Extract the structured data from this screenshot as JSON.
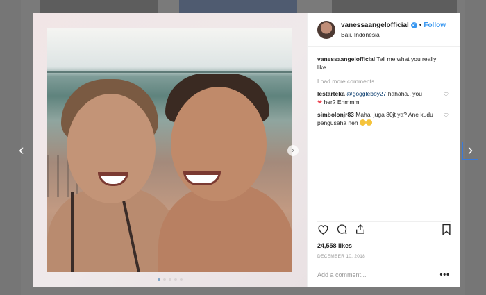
{
  "post": {
    "username": "vanessaangelofficial",
    "verified_icon": "✔",
    "separator": "•",
    "follow_label": "Follow",
    "location": "Bali, Indonesia",
    "caption_text": "Tell me what you really like..",
    "load_more_label": "Load more comments",
    "comments": [
      {
        "username": "lestarteka",
        "mention": "@goggleboy27",
        "text": "hahaha.. you",
        "text2": "her? Ehmmm",
        "heart": "❤"
      },
      {
        "username": "simbolonjr83",
        "text": "Mahal juga 80jt ya? Ane kudu pengusaha neh"
      }
    ],
    "likes": "24,558 likes",
    "date": "DECEMBER 10, 2018",
    "add_comment_placeholder": "Add a comment...",
    "more_options_icon": "•••"
  },
  "icons": {
    "heart": "heart-icon",
    "comment": "comment-icon",
    "share": "share-icon",
    "save": "bookmark-icon",
    "prev": "chevron-left-icon",
    "next": "chevron-right-icon",
    "carousel_next": "chevron-right-icon"
  },
  "nav": {
    "prev_glyph": "‹",
    "next_glyph": "›",
    "carousel_glyph": "›"
  },
  "colors": {
    "link": "#3897f0",
    "accent_heart": "#ed4956",
    "text": "#262626",
    "muted": "#999999"
  }
}
